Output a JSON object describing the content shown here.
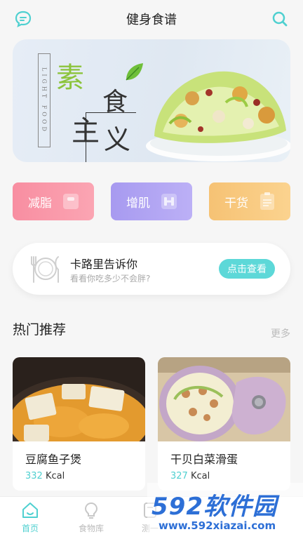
{
  "header": {
    "title": "健身食谱",
    "left_icon": "chat-bubble-icon",
    "right_icon": "search-icon",
    "accent": "#4fd0d0"
  },
  "banner": {
    "vertical_text": "LIGHT FOOD",
    "char1": "素",
    "char2": "食",
    "char3": "主",
    "char4": "义"
  },
  "categories": [
    {
      "label": "减脂",
      "icon": "scale-icon",
      "color": "#f88ea1"
    },
    {
      "label": "增肌",
      "icon": "dumbbell-icon",
      "color": "#a79af0"
    },
    {
      "label": "干货",
      "icon": "clipboard-icon",
      "color": "#f6c274"
    }
  ],
  "calorie_card": {
    "title": "卡路里告诉你",
    "subtitle": "看看你吃多少不会胖?",
    "button": "点击查看"
  },
  "recommend": {
    "title": "热门推荐",
    "more": "更多",
    "items": [
      {
        "name": "豆腐鱼子煲",
        "kcal_value": "332",
        "kcal_unit": "Kcal"
      },
      {
        "name": "干贝白菜滑蛋",
        "kcal_value": "327",
        "kcal_unit": "Kcal"
      }
    ]
  },
  "nav": {
    "items": [
      {
        "label": "首页",
        "icon": "home-icon",
        "active": true
      },
      {
        "label": "食物库",
        "icon": "lightbulb-icon",
        "active": false
      },
      {
        "label": "测一",
        "icon": "measure-icon",
        "active": false
      }
    ]
  },
  "watermark": {
    "brand": "592软件园",
    "url": "www.592xiazai.com"
  }
}
